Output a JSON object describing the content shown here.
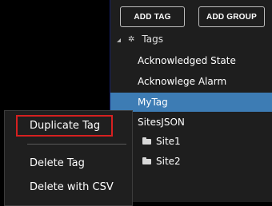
{
  "toolbar": {
    "add_tag_label": "ADD TAG",
    "add_group_label": "ADD GROUP"
  },
  "tree": {
    "root_label": "Tags",
    "items": [
      {
        "label": "Acknowledged State"
      },
      {
        "label": "Acknowlege Alarm"
      },
      {
        "label": "MyTag",
        "selected": true
      },
      {
        "label": "SitesJSON"
      }
    ],
    "children": [
      {
        "label": "Site1",
        "icon": "folder-icon"
      },
      {
        "label": "Site2",
        "icon": "folder-icon"
      }
    ]
  },
  "context_menu": {
    "items": [
      {
        "label": "Duplicate Tag",
        "highlighted": true
      },
      {
        "label": "Delete Tag"
      },
      {
        "label": "Delete with CSV"
      }
    ]
  },
  "colors": {
    "background": "#000000",
    "panel": "#1e1e1e",
    "selection": "#3d7cb4",
    "highlight_border": "#d62020",
    "divider": "#16206a"
  }
}
